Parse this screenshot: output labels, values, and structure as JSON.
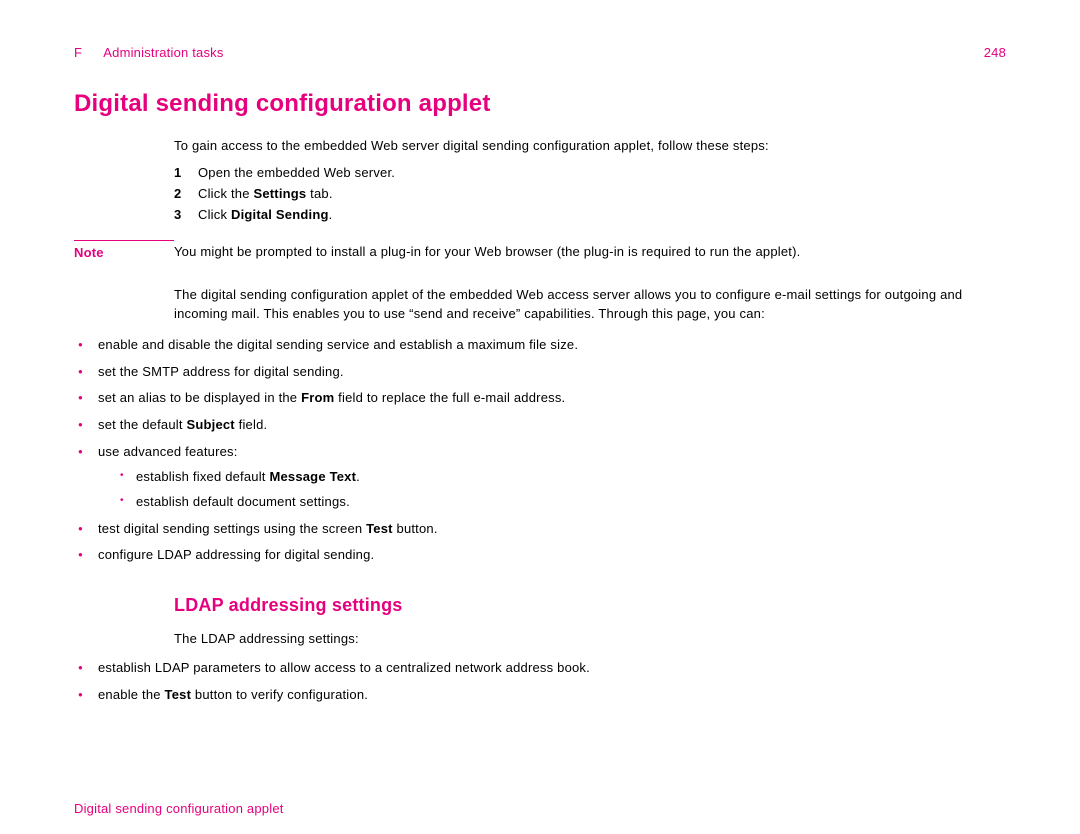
{
  "header": {
    "letter": "F",
    "section": "Administration tasks",
    "page": "248"
  },
  "h1": "Digital sending configuration applet",
  "intro": "To gain access to the embedded Web server digital sending configuration applet, follow these steps:",
  "steps": {
    "n1": "1",
    "t1a": "Open the embedded Web server.",
    "n2": "2",
    "t2a": "Click the ",
    "t2b": "Settings",
    "t2c": " tab.",
    "n3": "3",
    "t3a": "Click ",
    "t3b": "Digital Sending",
    "t3c": "."
  },
  "note": {
    "label": "Note",
    "text": "You might be prompted to install a plug-in for your Web browser (the plug-in is required to run the applet)."
  },
  "para1": "The digital sending configuration applet of the embedded Web access server allows you to configure e-mail settings for outgoing and incoming mail. This enables you to use “send and receive” capabilities. Through this page, you can:",
  "bullets1": {
    "b1": "enable and disable the digital sending service and establish a maximum file size.",
    "b2": "set the SMTP address for digital sending.",
    "b3a": "set an alias to be displayed in the ",
    "b3b": "From",
    "b3c": " field to replace the full e-mail address.",
    "b4a": "set the default ",
    "b4b": "Subject",
    "b4c": " field.",
    "b5": "use advanced features:",
    "s1a": "establish fixed default ",
    "s1b": "Message Text",
    "s1c": ".",
    "s2": "establish default document settings.",
    "b6a": " test digital sending settings using the screen ",
    "b6b": "Test",
    "b6c": " button.",
    "b7": "configure LDAP addressing for digital sending."
  },
  "h2": "LDAP addressing settings",
  "para2": "The LDAP addressing settings:",
  "bullets2": {
    "b1": "establish LDAP parameters to allow access to a centralized network address book.",
    "b2a": "enable the ",
    "b2b": "Test",
    "b2c": " button to verify configuration."
  },
  "footer": "Digital sending configuration applet"
}
